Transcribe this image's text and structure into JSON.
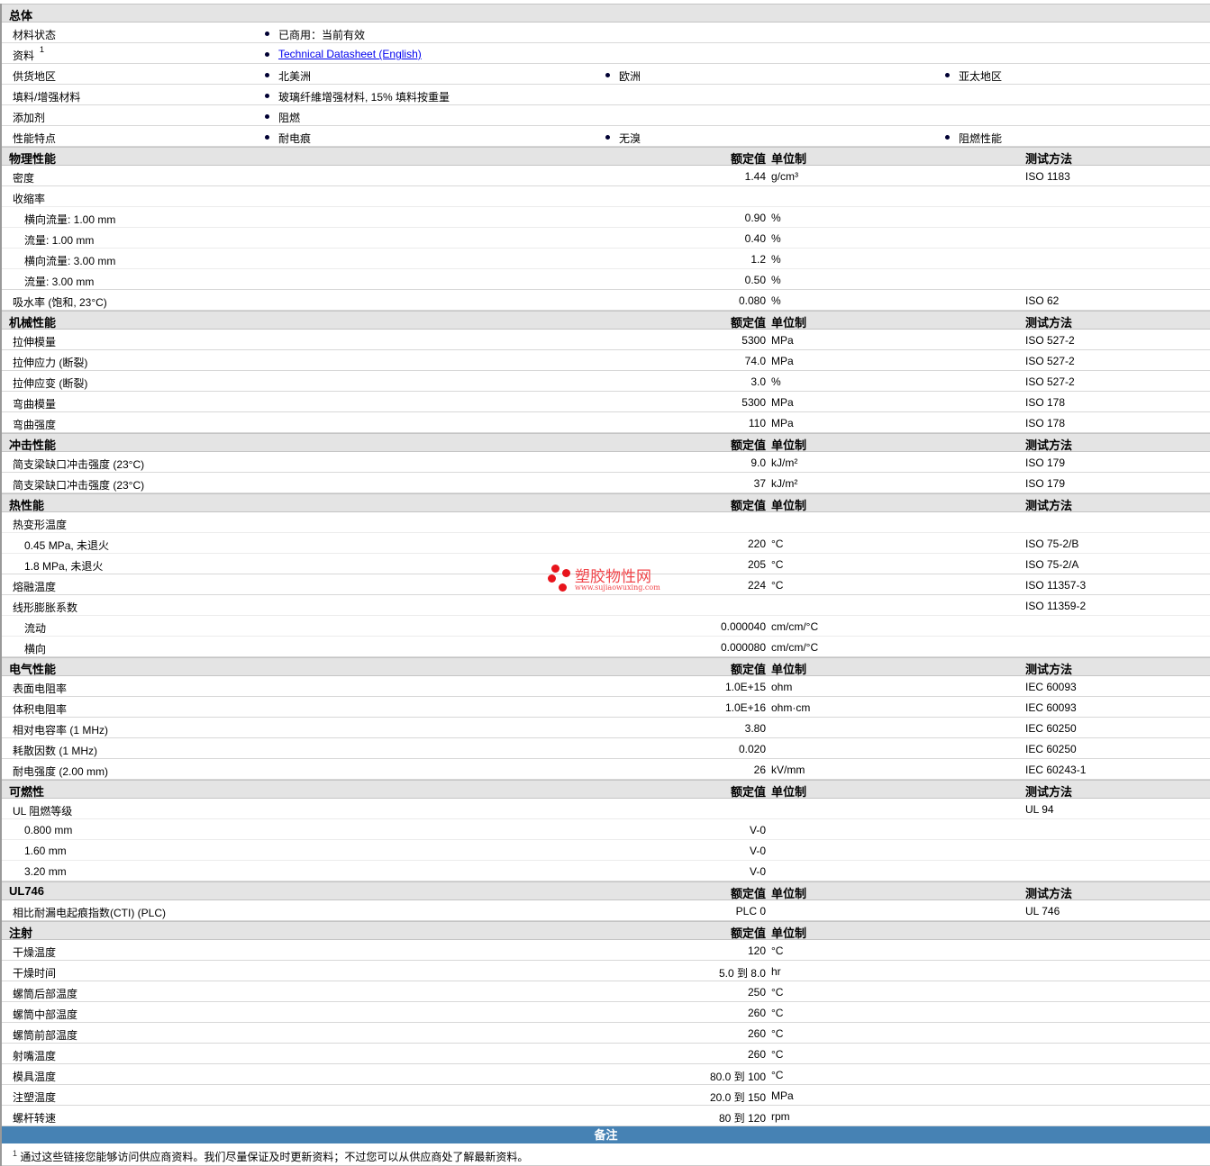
{
  "general": {
    "title": "总体",
    "rows": [
      {
        "label": "材料状态",
        "items": [
          "已商用：当前有效"
        ]
      },
      {
        "label": "资料",
        "sup": "1",
        "link": "Technical Datasheet (English)"
      },
      {
        "label": "供货地区",
        "items": [
          "北美洲",
          "欧洲",
          "亚太地区"
        ]
      },
      {
        "label": "填料/增强材料",
        "items": [
          "玻璃纤維增强材料, 15% 填料按重量"
        ]
      },
      {
        "label": "添加剂",
        "items": [
          "阻燃"
        ]
      },
      {
        "label": "性能特点",
        "items": [
          "耐电痕",
          "无溴",
          "阻燃性能"
        ]
      }
    ]
  },
  "col_headers": {
    "value": "额定值",
    "unit": "单位制",
    "method": "测试方法"
  },
  "sections": [
    {
      "title": "物理性能",
      "method_col": true,
      "rows": [
        {
          "label": "密度",
          "value": "1.44",
          "unit": "g/cm³",
          "method": "ISO 1183"
        },
        {
          "label": "收缩率",
          "sub_follow": true
        },
        {
          "label": "横向流量: 1.00 mm",
          "indent": true,
          "value": "0.90",
          "unit": "%"
        },
        {
          "label": "流量: 1.00 mm",
          "indent": true,
          "value": "0.40",
          "unit": "%"
        },
        {
          "label": "横向流量: 3.00 mm",
          "indent": true,
          "value": "1.2",
          "unit": "%"
        },
        {
          "label": "流量: 3.00 mm",
          "indent": true,
          "value": "0.50",
          "unit": "%"
        },
        {
          "label": "吸水率 (饱和, 23°C)",
          "value": "0.080",
          "unit": "%",
          "method": "ISO 62"
        }
      ]
    },
    {
      "title": "机械性能",
      "method_col": true,
      "rows": [
        {
          "label": "拉伸模量",
          "value": "5300",
          "unit": "MPa",
          "method": "ISO 527-2"
        },
        {
          "label": "拉伸应力 (断裂)",
          "value": "74.0",
          "unit": "MPa",
          "method": "ISO 527-2"
        },
        {
          "label": "拉伸应变 (断裂)",
          "value": "3.0",
          "unit": "%",
          "method": "ISO 527-2"
        },
        {
          "label": "弯曲模量",
          "value": "5300",
          "unit": "MPa",
          "method": "ISO 178"
        },
        {
          "label": "弯曲强度",
          "value": "110",
          "unit": "MPa",
          "method": "ISO 178"
        }
      ]
    },
    {
      "title": "冲击性能",
      "method_col": true,
      "rows": [
        {
          "label": "简支梁缺口冲击强度 (23°C)",
          "value": "9.0",
          "unit": "kJ/m²",
          "method": "ISO 179"
        },
        {
          "label": "简支梁缺口冲击强度 (23°C)",
          "value": "37",
          "unit": "kJ/m²",
          "method": "ISO 179"
        }
      ]
    },
    {
      "title": "热性能",
      "method_col": true,
      "rows": [
        {
          "label": "热变形温度",
          "sub_follow": true
        },
        {
          "label": "0.45 MPa, 未退火",
          "indent": true,
          "value": "220",
          "unit": "°C",
          "method": "ISO 75-2/B"
        },
        {
          "label": "1.8 MPa, 未退火",
          "indent": true,
          "value": "205",
          "unit": "°C",
          "method": "ISO 75-2/A"
        },
        {
          "label": "熔融温度",
          "value": "224",
          "unit": "°C",
          "method": "ISO 11357-3"
        },
        {
          "label": "线形膨胀系数",
          "method": "ISO 11359-2",
          "sub_follow": true
        },
        {
          "label": "流动",
          "indent": true,
          "value": "0.000040",
          "unit": "cm/cm/°C"
        },
        {
          "label": "横向",
          "indent": true,
          "value": "0.000080",
          "unit": "cm/cm/°C"
        }
      ]
    },
    {
      "title": "电气性能",
      "method_col": true,
      "rows": [
        {
          "label": "表面电阻率",
          "value": "1.0E+15",
          "unit": "ohm",
          "method": "IEC 60093"
        },
        {
          "label": "体积电阻率",
          "value": "1.0E+16",
          "unit": "ohm·cm",
          "method": "IEC 60093"
        },
        {
          "label": "相对电容率 (1 MHz)",
          "value": "3.80",
          "method": "IEC 60250"
        },
        {
          "label": "耗散因数 (1 MHz)",
          "value": "0.020",
          "method": "IEC 60250"
        },
        {
          "label": "耐电强度 (2.00 mm)",
          "value": "26",
          "unit": "kV/mm",
          "method": "IEC 60243-1"
        }
      ]
    },
    {
      "title": "可燃性",
      "method_col": true,
      "rows": [
        {
          "label": "UL 阻燃等级",
          "method": "UL 94",
          "sub_follow": true
        },
        {
          "label": "0.800 mm",
          "indent": true,
          "value": "V-0"
        },
        {
          "label": "1.60 mm",
          "indent": true,
          "value": "V-0"
        },
        {
          "label": "3.20 mm",
          "indent": true,
          "value": "V-0"
        }
      ]
    },
    {
      "title": "UL746",
      "method_col": true,
      "rows": [
        {
          "label": "相比耐漏电起痕指数(CTI) (PLC)",
          "value": "PLC 0",
          "method": "UL 746"
        }
      ]
    },
    {
      "title": "注射",
      "method_col": false,
      "rows": [
        {
          "label": "干燥温度",
          "value": "120",
          "unit": "°C"
        },
        {
          "label": "干燥时间",
          "value": "5.0 到  8.0",
          "unit": "hr"
        },
        {
          "label": "螺筒后部温度",
          "value": "250",
          "unit": "°C"
        },
        {
          "label": "螺筒中部温度",
          "value": "260",
          "unit": "°C"
        },
        {
          "label": "螺筒前部温度",
          "value": "260",
          "unit": "°C"
        },
        {
          "label": "射嘴温度",
          "value": "260",
          "unit": "°C"
        },
        {
          "label": "模具温度",
          "value": "80.0 到  100",
          "unit": "°C"
        },
        {
          "label": "注塑温度",
          "value": "20.0 到  150",
          "unit": "MPa"
        },
        {
          "label": "螺杆转速",
          "value": "80 到  120",
          "unit": "rpm"
        }
      ]
    }
  ],
  "notes": {
    "title": "备注",
    "footnote_num": "1",
    "footnote": "通过这些链接您能够访问供应商资料。我们尽量保证及时更新资料；不过您可以从供应商处了解最新资料。"
  },
  "watermark": {
    "name": "塑胶物性网",
    "url": "www.sujiaowuxing.com"
  },
  "colors": {
    "section_bg": "#e4e4e4",
    "notes_bg": "#4682b4",
    "link": "#0000ee",
    "watermark": "#e8141c"
  }
}
